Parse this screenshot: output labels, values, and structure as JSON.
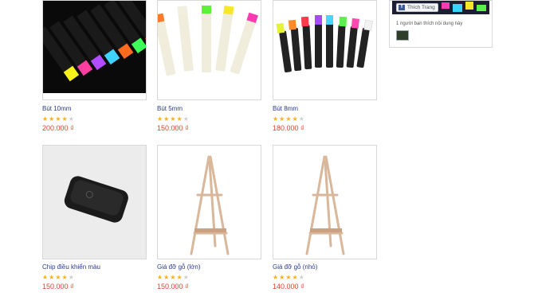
{
  "facebook": {
    "like_label": "Thích Trang",
    "friends_text": "1 người bạn thích nội dung này"
  },
  "colors": {
    "name_link": "#2b3a8f",
    "price": "#e0452b",
    "star_on": "#f2b01e",
    "star_off": "#cfcfcf"
  },
  "products": [
    {
      "name": "Bút 10mm",
      "price": "200.000 ₫",
      "rating": 4,
      "max_rating": 5,
      "image": "neon-marker-pens-chisel-tip"
    },
    {
      "name": "Bút 5mm",
      "price": "150.000 ₫",
      "rating": 4,
      "max_rating": 5,
      "image": "neon-marker-pens-5mm"
    },
    {
      "name": "Bút 8mm",
      "price": "180.000 ₫",
      "rating": 4,
      "max_rating": 5,
      "image": "neon-marker-pens-8mm"
    },
    {
      "name": "Chip điều khiển màu",
      "price": "150.000 ₫",
      "rating": 4,
      "max_rating": 5,
      "image": "color-control-chip"
    },
    {
      "name": "Giá đỡ gỗ (lớn)",
      "price": "150.000 ₫",
      "rating": 4,
      "max_rating": 5,
      "image": "wooden-easel-large"
    },
    {
      "name": "Giá đỡ gỗ (nhỏ)",
      "price": "140.000 ₫",
      "rating": 4,
      "max_rating": 5,
      "image": "wooden-easel-small"
    }
  ]
}
